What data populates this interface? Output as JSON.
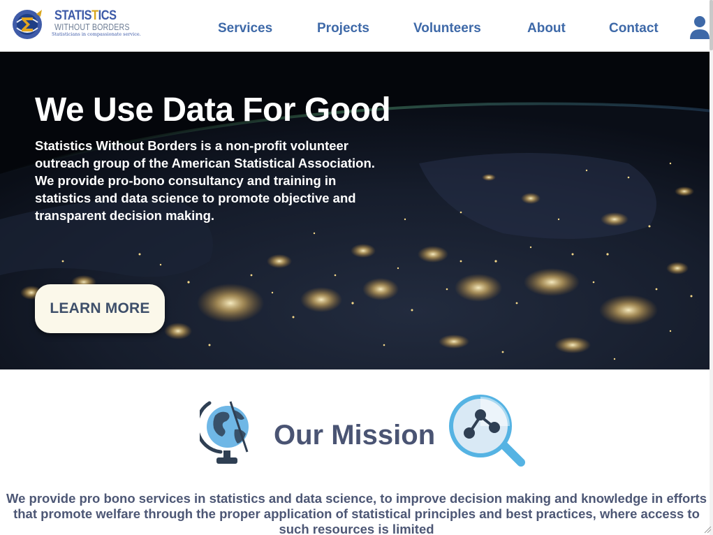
{
  "logo": {
    "title_main": "STATIS",
    "title_accent": "T",
    "title_end": "ICS",
    "subtitle": "WITHOUT BORDERS",
    "tagline": "Statisticians in compassionate service."
  },
  "nav": {
    "items": [
      "Services",
      "Projects",
      "Volunteers",
      "About",
      "Contact"
    ]
  },
  "hero": {
    "title": "We Use Data For Good",
    "description": "Statistics Without Borders is a non-profit volunteer outreach group of the American Statistical Association. We provide pro-bono consultancy and training in statistics and data science to promote objective and transparent decision making.",
    "button_label": "LEARN MORE"
  },
  "mission": {
    "title": "Our Mission",
    "text": "We provide pro bono services in statistics and data science, to improve decision making and knowledge in efforts that promote welfare through the proper application of statistical principles and best practices, where access to such resources is limited"
  },
  "colors": {
    "nav_text": "#3e69a8",
    "brand_blue": "#3d5aa8",
    "brand_gold": "#d8a51e",
    "heading": "#4a5473",
    "button_bg": "#fbf8ea"
  },
  "icons": [
    "logo-emblem-icon",
    "user-icon",
    "globe-icon",
    "network-magnifier-icon"
  ]
}
